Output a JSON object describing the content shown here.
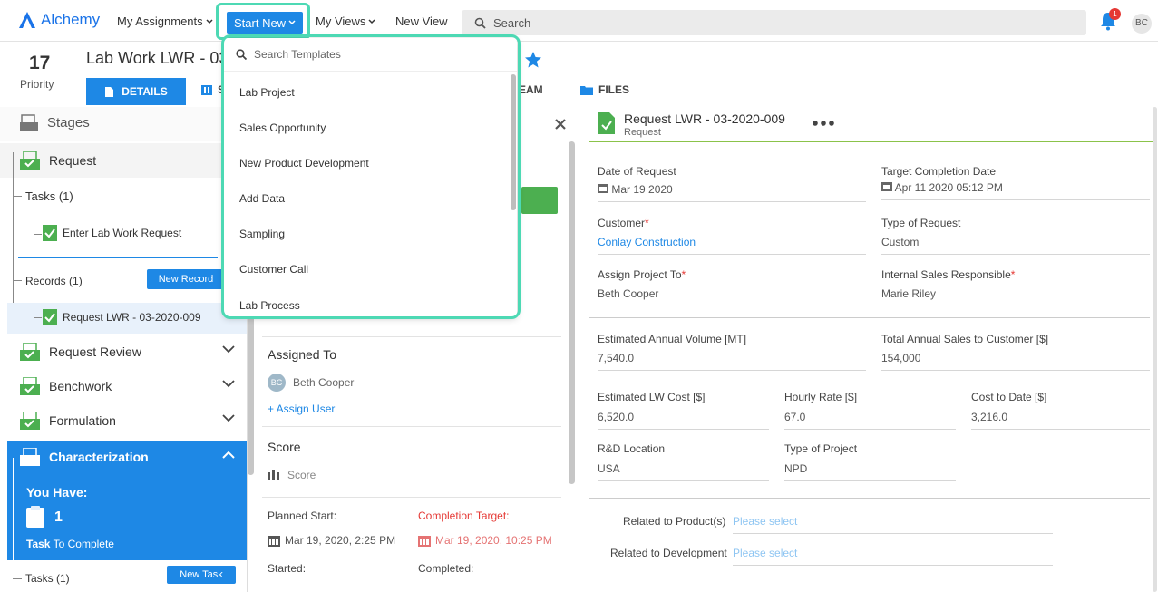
{
  "nav": {
    "logo": "Alchemy",
    "my_assignments": "My Assignments",
    "start_new": "Start New",
    "my_views": "My Views",
    "new_view": "New View",
    "search_placeholder": "Search",
    "notifications_count": "1",
    "user_initials": "BC"
  },
  "header": {
    "priority_value": "17",
    "priority_label": "Priority",
    "title": "Lab Work LWR - 03",
    "tabs": {
      "details": "DETAILS",
      "s": "S",
      "team": "EAM",
      "files": "FILES"
    }
  },
  "stages": {
    "title": "Stages",
    "request": "Request",
    "tasks_label": "Tasks (1)",
    "task_item": "Enter Lab Work Request",
    "records_label": "Records (1)",
    "new_record": "New Record",
    "record_item": "Request LWR - 03-2020-009",
    "request_review": "Request Review",
    "benchwork": "Benchwork",
    "formulation": "Formulation",
    "characterization": "Characterization",
    "you_have": "You Have:",
    "task_count": "1",
    "task_to_complete_bold": "Task",
    "task_to_complete_rest": "To Complete",
    "tasks_bottom": "Tasks (1)",
    "new_task": "New Task"
  },
  "middle": {
    "assigned_to": "Assigned To",
    "assignee_initials": "BC",
    "assignee_name": "Beth Cooper",
    "assign_user": "+ Assign User",
    "score_label": "Score",
    "score_placeholder": "Score",
    "planned_start_label": "Planned Start:",
    "planned_start_value": "Mar 19, 2020, 2:25 PM",
    "completion_target_label": "Completion Target:",
    "completion_target_value": "Mar 19, 2020, 10:25 PM",
    "started_label": "Started:",
    "completed_label": "Completed:"
  },
  "record": {
    "title": "Request LWR - 03-2020-009",
    "subtitle": "Request",
    "fields": {
      "date_of_request_label": "Date of Request",
      "date_of_request": "Mar 19 2020",
      "target_completion_label": "Target Completion Date",
      "target_completion": "Apr 11 2020 05:12 PM",
      "customer_label": "Customer",
      "customer": "Conlay Construction",
      "type_of_request_label": "Type of Request",
      "type_of_request": "Custom",
      "assign_project_label": "Assign Project To",
      "assign_project": "Beth Cooper",
      "internal_sales_label": "Internal Sales Responsible",
      "internal_sales": "Marie Riley",
      "est_volume_label": "Estimated Annual Volume [MT]",
      "est_volume": "7,540.0",
      "total_sales_label": "Total Annual Sales to Customer [$]",
      "total_sales": "154,000",
      "est_cost_label": "Estimated LW Cost [$]",
      "est_cost": "6,520.0",
      "hourly_rate_label": "Hourly Rate [$]",
      "hourly_rate": "67.0",
      "cost_to_date_label": "Cost to Date [$]",
      "cost_to_date": "3,216.0",
      "rd_location_label": "R&D Location",
      "rd_location": "USA",
      "type_of_project_label": "Type of Project",
      "type_of_project": "NPD",
      "related_product_label": "Related to Product(s)",
      "related_development_label": "Related to Development",
      "please_select": "Please select",
      "required_mark": "*"
    }
  },
  "dropdown": {
    "search_placeholder": "Search Templates",
    "items": [
      "Lab Project",
      "Sales Opportunity",
      "New Product Development",
      "Add Data",
      "Sampling",
      "Customer Call",
      "Lab Process"
    ]
  },
  "colors": {
    "accent": "#1e88e5",
    "highlight": "#4dd9b4",
    "success": "#4caf50",
    "danger": "#e53935"
  }
}
